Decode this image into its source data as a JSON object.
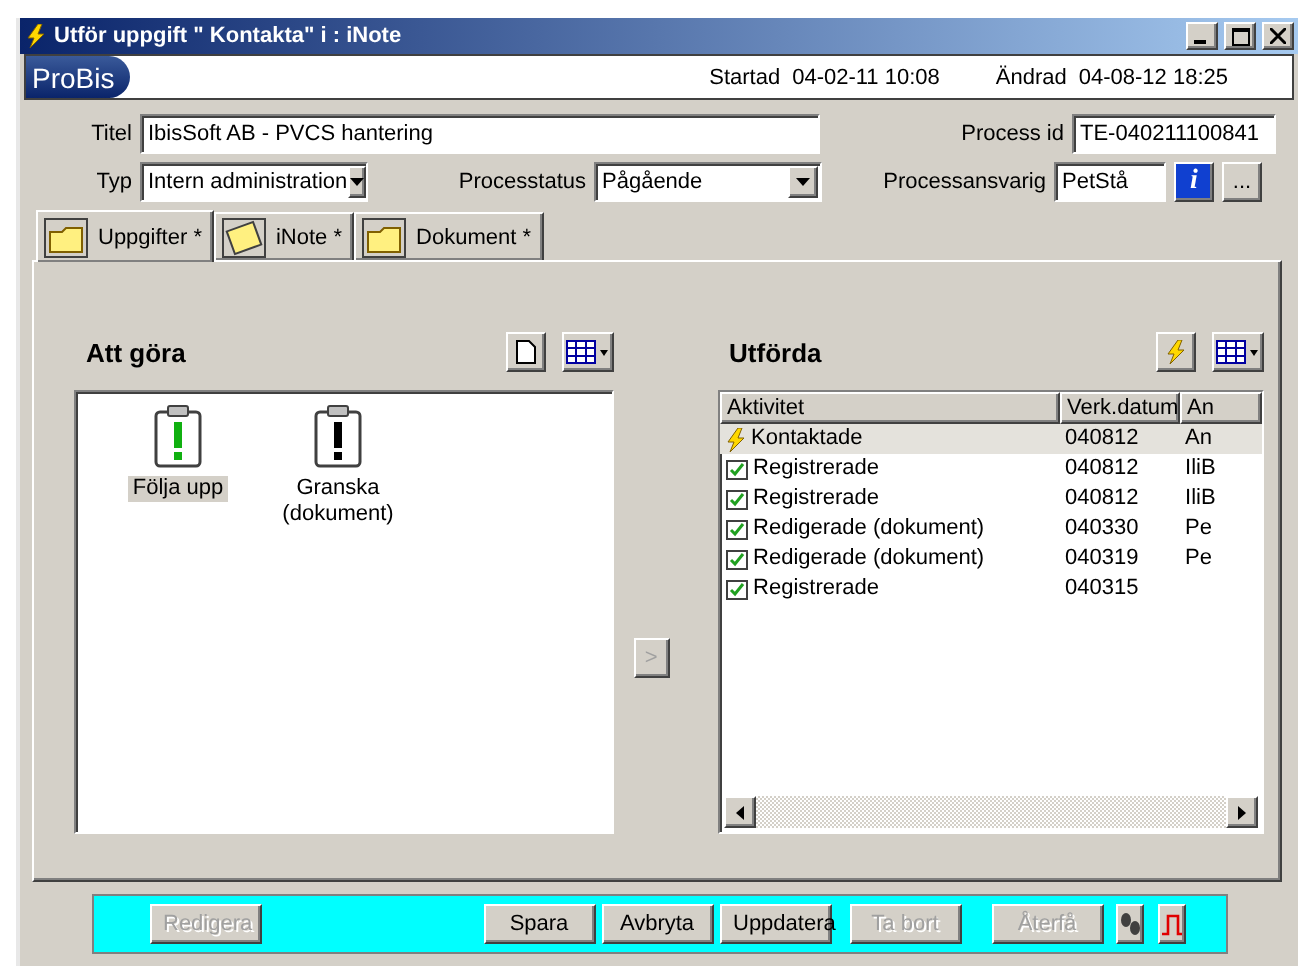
{
  "window": {
    "title": "Utför uppgift \" Kontakta\" i : iNote"
  },
  "header": {
    "brand": "ProBis",
    "started_label": "Startad",
    "started": "04-02-11 10:08",
    "changed_label": "Ändrad",
    "changed": "04-08-12 18:25"
  },
  "form": {
    "title_label": "Titel",
    "title_value": "IbisSoft AB - PVCS hantering",
    "process_id_label": "Process id",
    "process_id": "TE-040211100841",
    "type_label": "Typ",
    "type_value": "Intern administration",
    "status_label": "Processtatus",
    "status_value": "Pågående",
    "owner_label": "Processansvarig",
    "owner": "PetStå",
    "info_button": "i",
    "more_button": "..."
  },
  "tabs": [
    {
      "label": "Uppgifter *",
      "kind": "folder",
      "selected": true
    },
    {
      "label": "iNote *",
      "kind": "note",
      "selected": false
    },
    {
      "label": "Dokument *",
      "kind": "folder",
      "selected": false
    }
  ],
  "todo": {
    "heading": "Att göra",
    "items": [
      {
        "label": "Följa upp",
        "kind": "green",
        "selected": true
      },
      {
        "label": "Granska (dokument)",
        "kind": "black",
        "selected": false
      }
    ]
  },
  "move_button": ">",
  "done": {
    "heading": "Utförda",
    "columns": [
      "Aktivitet",
      "Verk.datum",
      "An"
    ],
    "rows": [
      {
        "kind": "lightning",
        "cells": [
          "Kontaktade",
          "040812",
          "An"
        ],
        "selected": true
      },
      {
        "kind": "check",
        "cells": [
          "Registrerade",
          "040812",
          "IliB"
        ],
        "selected": false
      },
      {
        "kind": "check",
        "cells": [
          "Registrerade",
          "040812",
          "IliB"
        ],
        "selected": false
      },
      {
        "kind": "check",
        "cells": [
          "Redigerade (dokument)",
          "040330",
          "Pe"
        ],
        "selected": false
      },
      {
        "kind": "check",
        "cells": [
          "Redigerade (dokument)",
          "040319",
          "Pe"
        ],
        "selected": false
      },
      {
        "kind": "check",
        "cells": [
          "Registrerade",
          "040315",
          ""
        ],
        "selected": false
      }
    ]
  },
  "buttons": [
    {
      "label": "Redigera",
      "disabled": true
    },
    {
      "label": "Spara",
      "disabled": false
    },
    {
      "label": "Avbryta",
      "disabled": false
    },
    {
      "label": "Uppdatera",
      "disabled": false
    },
    {
      "label": "Ta bort",
      "disabled": true
    },
    {
      "label": "Återfå",
      "disabled": true
    }
  ]
}
